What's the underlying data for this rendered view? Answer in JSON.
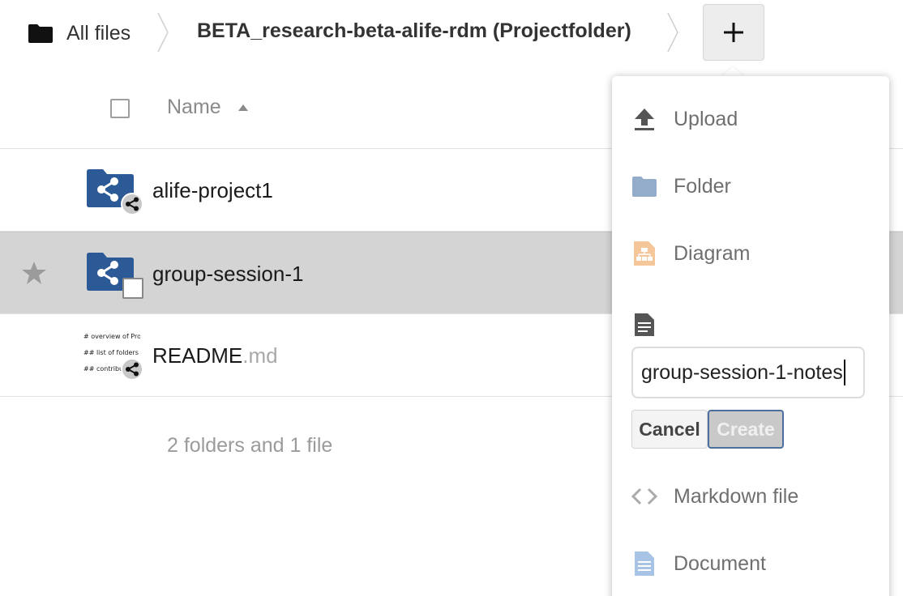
{
  "breadcrumb": {
    "home_label": "All files",
    "current_label": "BETA_research-beta-alife-rdm (Projectfolder)",
    "home_icon": "folder-icon",
    "add_icon": "plus-icon"
  },
  "file_list": {
    "name_column": "Name",
    "sort_icon": "sort-ascending-icon",
    "rows": [
      {
        "name": "alife-project1",
        "type": "shared-folder",
        "badge": "share-icon"
      },
      {
        "name": "group-session-1",
        "type": "shared-folder",
        "badge": "checkbox",
        "selected": true
      },
      {
        "name": "README",
        "ext": ".md",
        "type": "markdown-file",
        "badge": "share-icon",
        "preview_lines": [
          "# overview of Pro",
          "## list of folders",
          "## contribut"
        ]
      }
    ],
    "summary": "2 folders and 1 file"
  },
  "new_menu": {
    "items": [
      {
        "label": "Upload",
        "icon": "upload-icon"
      },
      {
        "label": "Folder",
        "icon": "folder-icon"
      },
      {
        "label": "Diagram",
        "icon": "diagram-icon"
      }
    ],
    "new_file": {
      "icon": "text-file-icon",
      "value": "group-session-1-notes",
      "cancel_label": "Cancel",
      "create_label": "Create"
    },
    "items_after": [
      {
        "label": "Markdown file",
        "icon": "code-brackets-icon"
      },
      {
        "label": "Document",
        "icon": "document-icon"
      }
    ]
  },
  "colors": {
    "folder_blue": "#2c5a96",
    "selected_row": "#d4d4d4",
    "menu_text": "#6f6f6f",
    "create_border": "#4a6fa0",
    "diagram_orange": "#f0a35e",
    "folder_menu_blue": "#93acca",
    "document_blue": "#a7c4e6"
  }
}
